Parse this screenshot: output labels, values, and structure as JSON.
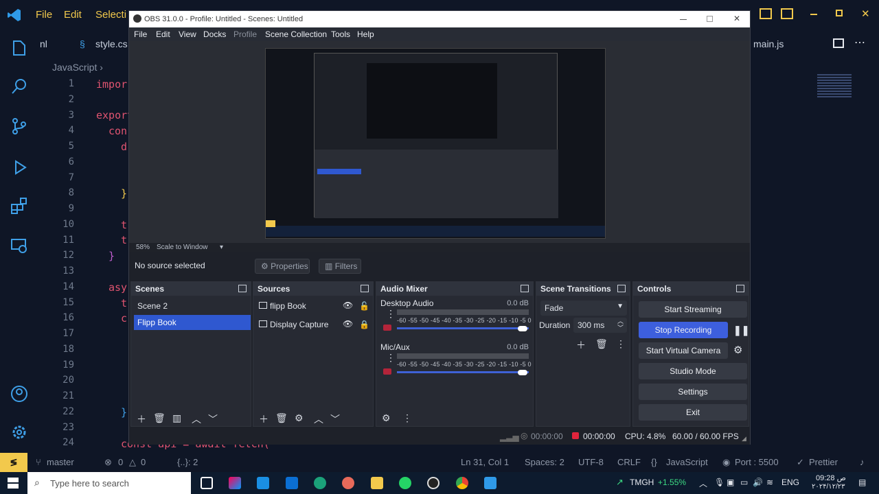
{
  "vscode": {
    "menu": [
      "File",
      "Edit",
      "Selecti"
    ],
    "tabs": [
      "style.cs",
      "main.js"
    ],
    "tab_left_stub": "nl",
    "breadcrumb": "JavaScript",
    "line_numbers": [
      "1",
      "2",
      "3",
      "4",
      "5",
      "6",
      "7",
      "8",
      "9",
      "10",
      "11",
      "12",
      "13",
      "14",
      "15",
      "16",
      "17",
      "18",
      "19",
      "20",
      "21",
      "22",
      "23",
      "24"
    ],
    "code_fragments": {
      "l1": "impor",
      "l3": "export",
      "l4": "con",
      "l5": "d",
      "l8": "}",
      "l10": "t",
      "l11": "t",
      "l12": "}",
      "l14": "asy",
      "l15": "t",
      "l16": "c",
      "l22": "}",
      "l24": "const api = await fetch("
    },
    "status": {
      "branch": "master",
      "errors": "0",
      "warnings": "0",
      "scope": "{..}: 2",
      "position": "Ln 31, Col 1",
      "spaces": "Spaces: 2",
      "encoding": "UTF-8",
      "eol": "CRLF",
      "language": "JavaScript",
      "port": "Port : 5500",
      "formatter": "Prettier"
    }
  },
  "obs": {
    "title": "OBS 31.0.0 - Profile: Untitled - Scenes: Untitled",
    "menu": [
      "File",
      "Edit",
      "View",
      "Docks",
      "Profile",
      "Scene Collection",
      "Tools",
      "Help"
    ],
    "zoom": "58%",
    "scale_mode": "Scale to Window",
    "no_source": "No source selected",
    "properties_label": "Properties",
    "filters_label": "Filters",
    "scenes": {
      "title": "Scenes",
      "items": [
        "Scene 2",
        "Flipp Book"
      ],
      "selected": 1
    },
    "sources": {
      "title": "Sources",
      "items": [
        "flipp Book",
        "Display Capture"
      ]
    },
    "mixer": {
      "title": "Audio Mixer",
      "channels": [
        {
          "name": "Desktop Audio",
          "db": "0.0 dB",
          "volume_fraction": 1.0
        },
        {
          "name": "Mic/Aux",
          "db": "0.0 dB",
          "volume_fraction": 1.0
        }
      ],
      "ticks": "-60 -55 -50 -45 -40 -35 -30 -25 -20 -15 -10 -5 0"
    },
    "transitions": {
      "title": "Scene Transitions",
      "type": "Fade",
      "duration_label": "Duration",
      "duration": "300 ms"
    },
    "controls": {
      "title": "Controls",
      "buttons": [
        "Start Streaming",
        "Stop Recording",
        "Start Virtual Camera",
        "Studio Mode",
        "Settings",
        "Exit"
      ]
    },
    "status": {
      "stream_time": "00:00:00",
      "rec_time": "00:00:00",
      "cpu": "CPU: 4.8%",
      "fps": "60.00 / 60.00 FPS"
    }
  },
  "taskbar": {
    "search_placeholder": "Type here to search",
    "ticker": "TMGH",
    "ticker_change": "+1.55%",
    "lang": "ENG",
    "time": "09:28 ص",
    "date": "۲۰۲۴/۱۲/۲۳"
  },
  "colors": {
    "accent": "#2f58d0",
    "vs_yellow": "#f2c94c",
    "code_red": "#e05470"
  }
}
